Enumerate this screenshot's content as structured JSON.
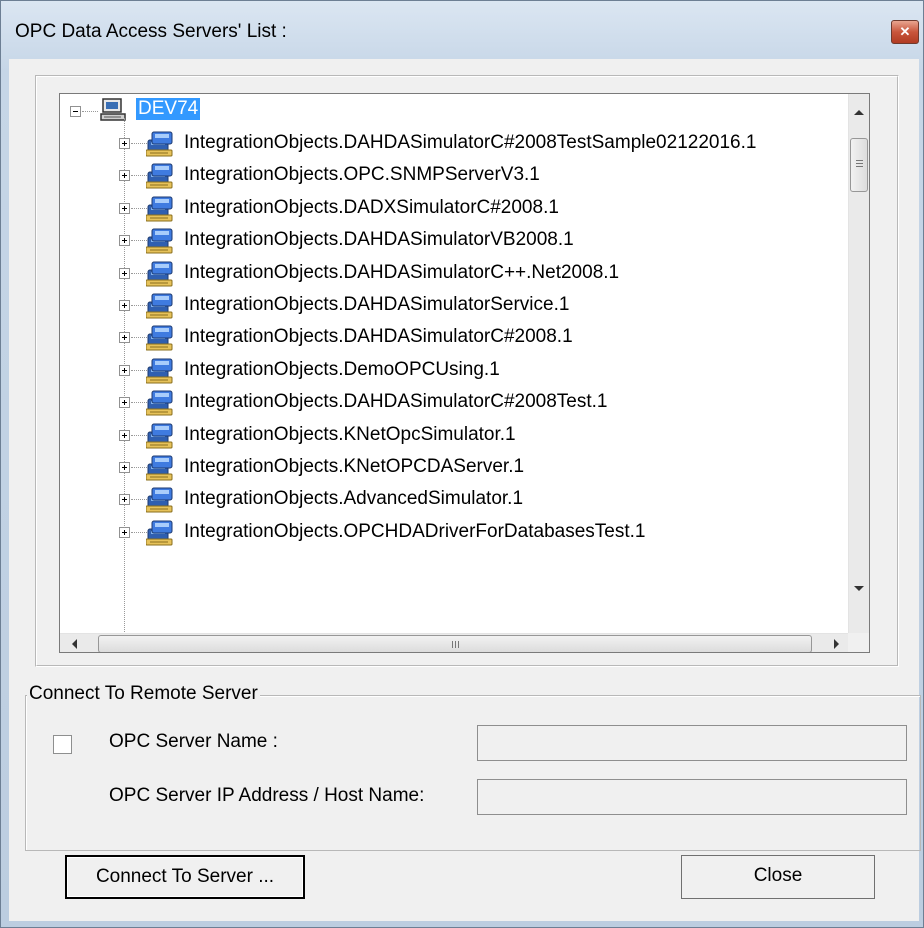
{
  "window": {
    "title": "OPC Data Access Servers' List :"
  },
  "tree": {
    "root": {
      "label": "DEV74",
      "icon": "computer-icon"
    },
    "servers": [
      "IntegrationObjects.DAHDASimulatorC#2008TestSample02122016.1",
      "IntegrationObjects.OPC.SNMPServerV3.1",
      "IntegrationObjects.DADXSimulatorC#2008.1",
      "IntegrationObjects.DAHDASimulatorVB2008.1",
      "IntegrationObjects.DAHDASimulatorC++.Net2008.1",
      "IntegrationObjects.DAHDASimulatorService.1",
      "IntegrationObjects.DAHDASimulatorC#2008.1",
      "IntegrationObjects.DemoOPCUsing.1",
      "IntegrationObjects.DAHDASimulatorC#2008Test.1",
      "IntegrationObjects.KNetOpcSimulator.1",
      "IntegrationObjects.KNetOPCDAServer.1",
      "IntegrationObjects.AdvancedSimulator.1",
      "IntegrationObjects.OPCHDADriverForDatabasesTest.1"
    ],
    "server_icon": "opc-server-icon"
  },
  "remote": {
    "legend": "Connect To Remote Server",
    "server_name_label": "OPC Server Name :",
    "server_name_value": "",
    "ip_label": "OPC Server IP Address / Host Name:",
    "ip_value": "",
    "checked": false
  },
  "buttons": {
    "connect": "Connect To Server ...",
    "close": "Close"
  },
  "colors": {
    "selection": "#3399ff",
    "close_button": "#c8553b"
  }
}
